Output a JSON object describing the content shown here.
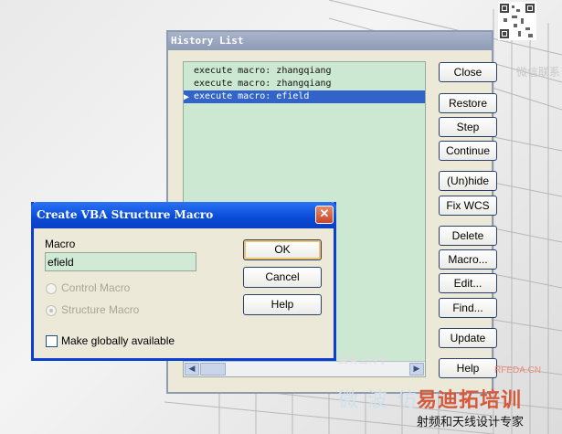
{
  "history_window": {
    "title": "History List",
    "entries": [
      {
        "text": "execute macro: zhangqiang",
        "selected": false
      },
      {
        "text": "execute macro: zhangqiang",
        "selected": false
      },
      {
        "text": "execute macro: efield",
        "selected": true
      }
    ],
    "buttons": {
      "close": "Close",
      "restore": "Restore",
      "step": "Step",
      "continue": "Continue",
      "unhide": "(Un)hide",
      "fix_wcs": "Fix WCS",
      "delete": "Delete",
      "macro": "Macro...",
      "edit": "Edit...",
      "find": "Find...",
      "update": "Update",
      "help": "Help"
    }
  },
  "dialog": {
    "title": "Create VBA Structure Macro",
    "macro_label": "Macro",
    "macro_value": "efield",
    "radio_control": "Control Macro",
    "radio_structure": "Structure Macro",
    "checkbox_global": "Make globally available",
    "ok": "OK",
    "cancel": "Cancel",
    "help": "Help"
  },
  "watermark": {
    "wechat": "微信联系",
    "domain": "RFEDA.CN",
    "brand": "易迪拓培训",
    "subtitle": "射频和天线设计专家",
    "faint_top": "国有上传于",
    "faint": "微波仿"
  },
  "colors": {
    "list_bg": "#cde8d2",
    "selection": "#3163c8",
    "dialog_title": "#0a4ad6"
  }
}
